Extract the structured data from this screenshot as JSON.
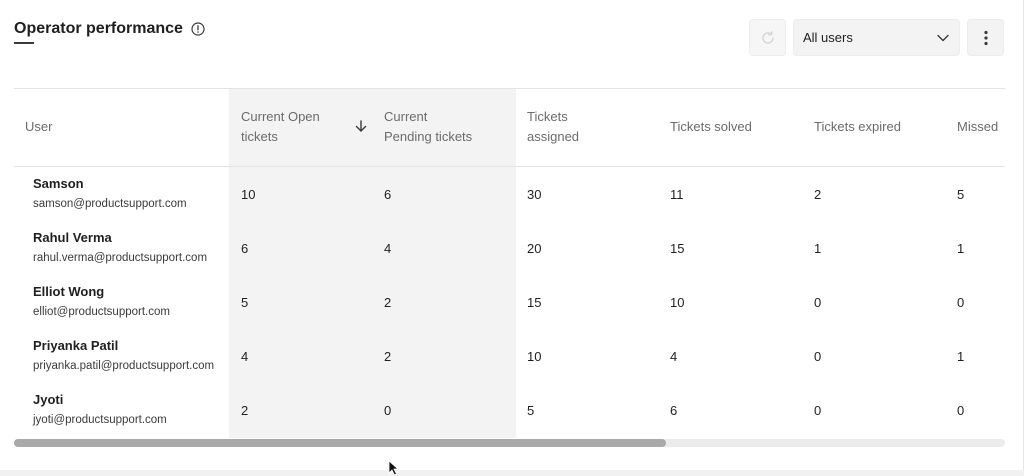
{
  "header": {
    "title": "Operator performance",
    "info_icon": "info-circle-icon",
    "refresh_icon": "refresh-icon",
    "user_filter": {
      "selected": "All users"
    },
    "more_icon": "kebab-menu-icon"
  },
  "table": {
    "columns": [
      {
        "line1": "User",
        "line2": ""
      },
      {
        "line1": "Current Open",
        "line2": "tickets",
        "sort": "descending"
      },
      {
        "line1": "Current",
        "line2": "Pending tickets"
      },
      {
        "line1": "Tickets",
        "line2": "assigned"
      },
      {
        "line1": "Tickets solved",
        "line2": ""
      },
      {
        "line1": "Tickets expired",
        "line2": ""
      },
      {
        "line1": "Missed",
        "line2": ""
      }
    ],
    "rows": [
      {
        "name": "Samson",
        "email": "samson@productsupport.com",
        "open": "10",
        "pending": "6",
        "assigned": "30",
        "solved": "11",
        "expired": "2",
        "missed": "5"
      },
      {
        "name": "Rahul Verma",
        "email": "rahul.verma@productsupport.com",
        "open": "6",
        "pending": "4",
        "assigned": "20",
        "solved": "15",
        "expired": "1",
        "missed": "1"
      },
      {
        "name": "Elliot Wong",
        "email": "elliot@productsupport.com",
        "open": "5",
        "pending": "2",
        "assigned": "15",
        "solved": "10",
        "expired": "0",
        "missed": "0"
      },
      {
        "name": "Priyanka Patil",
        "email": "priyanka.patil@productsupport.com",
        "open": "4",
        "pending": "2",
        "assigned": "10",
        "solved": "4",
        "expired": "0",
        "missed": "1"
      },
      {
        "name": "Jyoti",
        "email": "jyoti@productsupport.com",
        "open": "2",
        "pending": "0",
        "assigned": "5",
        "solved": "6",
        "expired": "0",
        "missed": "0"
      }
    ]
  },
  "colors": {
    "highlight_column_bg": "#f3f3f3",
    "scroll_thumb": "#a9a9a9",
    "header_text": "#6b6b6b"
  }
}
